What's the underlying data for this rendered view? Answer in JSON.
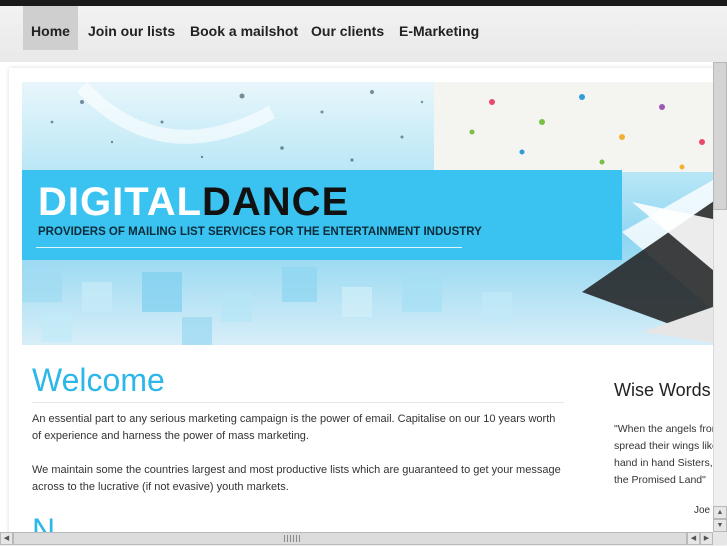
{
  "nav": {
    "items": [
      {
        "label": "Home"
      },
      {
        "label": "Join our lists"
      },
      {
        "label": "Book a mailshot"
      },
      {
        "label": "Our clients"
      },
      {
        "label": "E-Marketing"
      }
    ]
  },
  "banner": {
    "brand_part1": "DIGITAL",
    "brand_part2": "DANCE",
    "tagline": "PROVIDERS OF MAILING LIST SERVICES FOR THE ENTERTAINMENT INDUSTRY"
  },
  "main": {
    "heading": "Welcome",
    "paragraph1": "An essential part to any serious marketing campaign is the power of email. Capitalise on our 10 years worth of experience and harness the power of mass marketing.",
    "paragraph2": "We maintain some the countries largest and most productive lists which are guaranteed to get your message across to the lucrative (if not evasive) youth markets.",
    "next_heading_partial": "N"
  },
  "sidebar": {
    "title": "Wise Words",
    "quote": "\"When the angels from spread their wings like hand in hand Sisters, b the Promised Land\"",
    "author": "Joe"
  },
  "colors": {
    "accent": "#2cb7e8",
    "banner_band": "#3ac3f0",
    "nav_active_bg": "#cfcfcf"
  },
  "icons": {
    "scroll_up": "up-arrow-icon",
    "scroll_down": "down-arrow-icon",
    "scroll_left": "left-arrow-icon",
    "scroll_right": "right-arrow-icon"
  }
}
